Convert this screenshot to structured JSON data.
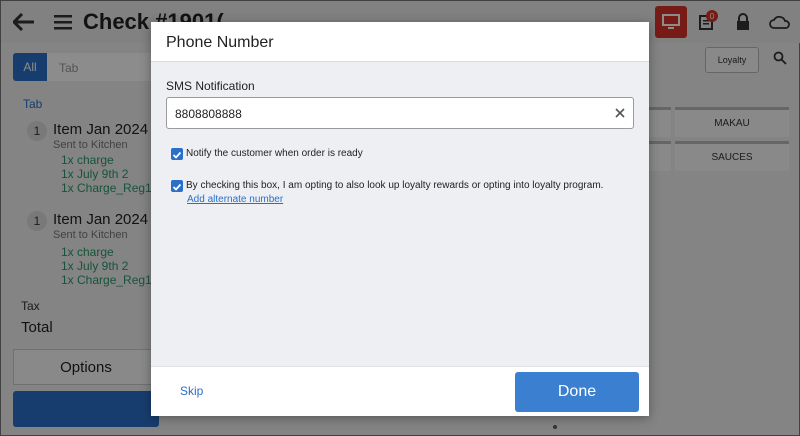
{
  "header": {
    "check_title": "Check #1901(",
    "notification_count": "0"
  },
  "order_panel": {
    "tabs": [
      {
        "label": "All"
      },
      {
        "label": "Tab"
      }
    ],
    "section_label": "Tab",
    "items": [
      {
        "qty": "1",
        "name": "Item Jan 2024",
        "status": "Sent to Kitchen",
        "modifiers": [
          "1x  charge",
          "1x  July 9th 2",
          "1x  Charge_Reg1"
        ]
      },
      {
        "qty": "1",
        "name": "Item Jan 2024",
        "status": "Sent to Kitchen",
        "modifiers": [
          "1x  charge",
          "1x  July 9th 2",
          "1x  Charge_Reg1"
        ]
      }
    ],
    "tax_label": "Tax",
    "total_label": "Total",
    "options_label": "Options"
  },
  "menu_panel": {
    "loyalty_label": "Loyalty",
    "categories": [
      "",
      "MAKAU",
      "",
      "SAUCES"
    ]
  },
  "modal": {
    "title": "Phone Number",
    "sms_label": "SMS Notification",
    "phone_value": "8808808888",
    "notify_text": "Notify the customer when order is ready",
    "notify_checked": true,
    "loyalty_text": "By checking this box, I am opting to also look up loyalty rewards or opting into loyalty program.",
    "loyalty_checked": true,
    "alt_number_link": "Add alternate number",
    "skip_label": "Skip",
    "done_label": "Done"
  },
  "colors": {
    "primary_blue": "#2a6fc9",
    "done_blue": "#3a7fd0",
    "alert_red": "#d9322b",
    "modifier_green": "#2a9a6a"
  }
}
